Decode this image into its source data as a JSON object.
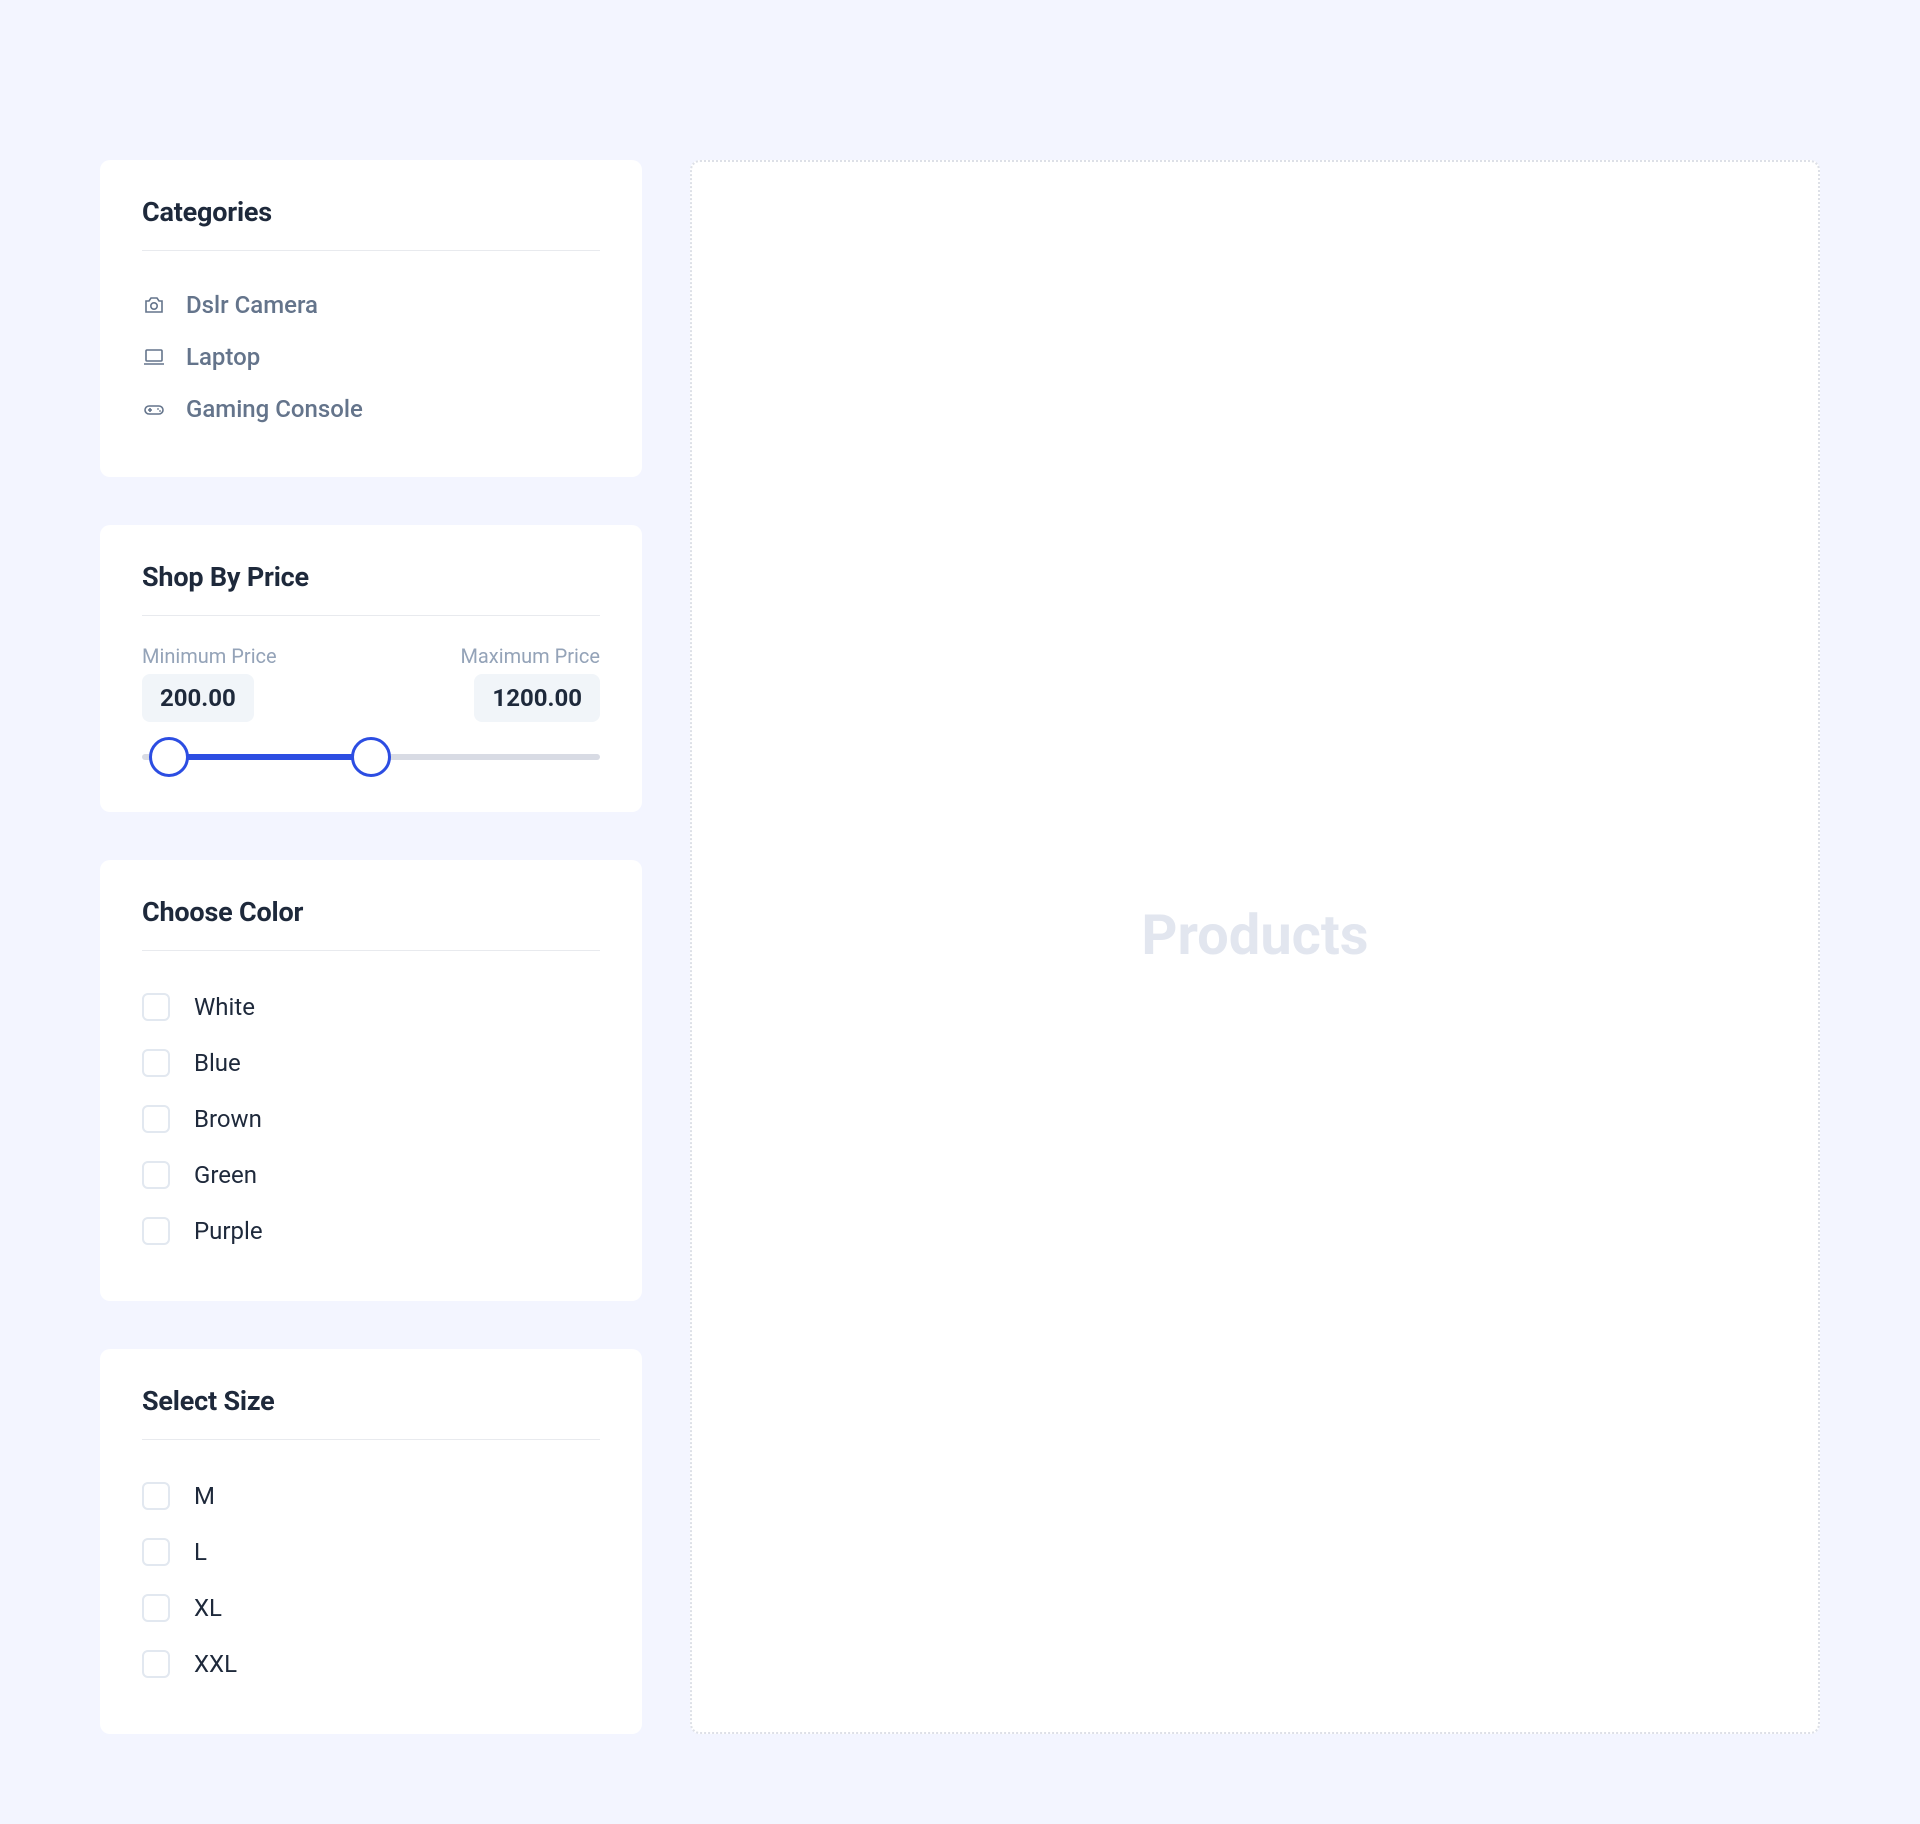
{
  "categories": {
    "title": "Categories",
    "items": [
      {
        "icon": "camera-icon",
        "label": "Dslr Camera"
      },
      {
        "icon": "laptop-icon",
        "label": "Laptop"
      },
      {
        "icon": "gamepad-icon",
        "label": "Gaming Console"
      }
    ]
  },
  "price": {
    "title": "Shop By Price",
    "min_label": "Minimum Price",
    "max_label": "Maximum Price",
    "min_value": "200.00",
    "max_value": "1200.00",
    "slider_min_percent": 6,
    "slider_max_percent": 50
  },
  "color": {
    "title": "Choose Color",
    "options": [
      {
        "label": "White"
      },
      {
        "label": "Blue"
      },
      {
        "label": "Brown"
      },
      {
        "label": "Green"
      },
      {
        "label": "Purple"
      }
    ]
  },
  "size": {
    "title": "Select Size",
    "options": [
      {
        "label": "M"
      },
      {
        "label": "L"
      },
      {
        "label": "XL"
      },
      {
        "label": "XXL"
      }
    ]
  },
  "main": {
    "placeholder": "Products"
  }
}
